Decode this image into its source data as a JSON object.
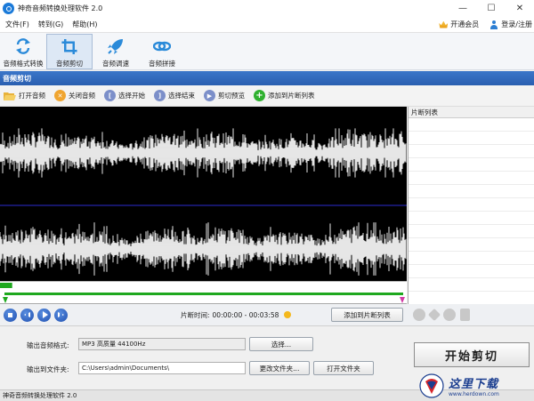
{
  "window": {
    "title": "神奇音频转换处理软件 2.0",
    "controls": [
      "—",
      "☐",
      "✕"
    ]
  },
  "menu": {
    "items": [
      "文件(F)",
      "转到(G)",
      "帮助(H)"
    ],
    "vip_label": "开通会员",
    "login_label": "登录/注册"
  },
  "toolbar": {
    "tools": [
      {
        "label": "音频格式转换",
        "icon": "convert-icon"
      },
      {
        "label": "音频剪切",
        "icon": "crop-icon",
        "active": true
      },
      {
        "label": "音频调速",
        "icon": "rocket-icon"
      },
      {
        "label": "音频拼接",
        "icon": "link-icon"
      }
    ]
  },
  "section": {
    "title": "音频剪切"
  },
  "actions": {
    "open": "打开音频",
    "close": "关闭音频",
    "select_start": "选择开始",
    "select_end": "选择结束",
    "preview": "剪切预览",
    "add_to_list": "添加到片断列表"
  },
  "fragments": {
    "header": "片断列表"
  },
  "player": {
    "cut_time_label": "片断时间:",
    "cut_time_value": "00:00:00 - 00:03:58",
    "add_button": "添加到片断列表",
    "progress": 0.03
  },
  "output": {
    "format_label": "输出音频格式:",
    "format_value": "MP3 高质量 44100Hz",
    "choose_button": "选择...",
    "folder_label": "输出到文件夹:",
    "folder_value": "C:\\Users\\admin\\Documents\\",
    "change_folder_button": "更改文件夹...",
    "open_folder_button": "打开文件夹"
  },
  "start_button": "开始剪切",
  "status": {
    "text": "神奇音频转换处理软件 2.0"
  },
  "watermark": {
    "cn": "这里下载",
    "url": "www.herdown.com"
  },
  "colors": {
    "accent": "#2a5fb0",
    "waveform_bg": "#000000",
    "waveform": "#ffffff",
    "center_line": "#2b2bd0",
    "range_bar": "#1ea81e",
    "start_button_text": "#222222"
  }
}
